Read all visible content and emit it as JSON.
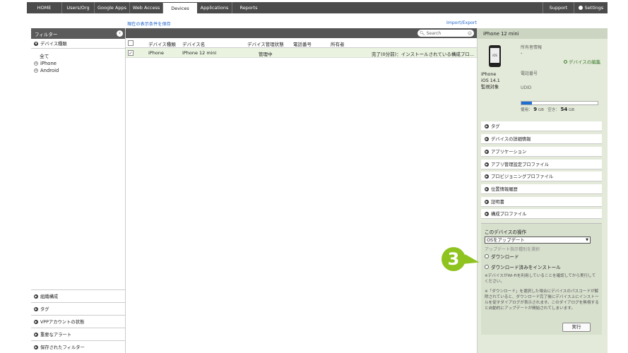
{
  "nav": {
    "tabs": [
      {
        "label": "HOME"
      },
      {
        "label": "Users/Org"
      },
      {
        "label": "Google Apps"
      },
      {
        "label": "Web Access"
      },
      {
        "label": "Devices"
      },
      {
        "label": "Applications"
      },
      {
        "label": "Reports"
      }
    ],
    "support": "Support",
    "settings": "Settings"
  },
  "links": {
    "save_view": "現在の表示条件を保存",
    "import_export": "Import/Export"
  },
  "filter": {
    "title": "フィルター",
    "device_type": "デバイス種類",
    "tree": [
      "全て",
      "iPhone",
      "Android"
    ],
    "bottom_sections": [
      "組織構成",
      "タグ",
      "VPPアカウントの状態",
      "重要なアラート",
      "保存されたフィルター"
    ]
  },
  "table": {
    "search_placeholder": "Search",
    "headers": [
      "デバイス種類",
      "デバイス名",
      "デバイス管理状態",
      "電話番号",
      "所有者"
    ],
    "rows": [
      {
        "type": "iPhone",
        "name": "iPhone 12 mini",
        "status": "管理中",
        "phone": "",
        "owner": "",
        "install": "完了(0分前)：インストールされている構成プロ..."
      }
    ]
  },
  "detail": {
    "title": "iPhone 12 mini",
    "device_lines": [
      "iPhone",
      "iOS 14.1",
      "監視対象"
    ],
    "owner_label": "所有者情報",
    "owner_value": "-",
    "edit_label": "デバイスの編集",
    "phone_label": "電話番号",
    "udid_label": "UDID",
    "storage_used_label": "使用：",
    "storage_used": "9",
    "storage_free_label": "空き：",
    "storage_free": "54",
    "storage_unit": "GB",
    "storage_used_fraction": 0.14,
    "accordion": [
      "タグ",
      "デバイスの詳細情報",
      "アプリケーション",
      "アプリ管理設定プロファイル",
      "プロビジョニングプロファイル",
      "位置情報履歴",
      "証明書",
      "構成プロファイル"
    ],
    "ops": {
      "title": "このデバイスの操作",
      "selected": "OSをアップデート",
      "sub_label": "アップデート指示種別を選択",
      "radio_download": "ダウンロード",
      "radio_install": "ダウンロード済みをインストール",
      "note1": "※デバイスがWi-Fiを利用していることを確認してから実行してください。",
      "note2": "※「ダウンロード」を選択した場合にデバイスのパスコードが解除されていると、ダウンロード完了後にデバイス上にインストールを促すダイアログが表示されます。このダイアログを無視すると自動的にアップデートが開始されてしまいます。",
      "run": "実行"
    }
  },
  "callout": "3",
  "colors": {
    "accent_green": "#8fc31f",
    "bar_blue": "#1f6fd1",
    "nav_bg": "#4b4b4b"
  }
}
